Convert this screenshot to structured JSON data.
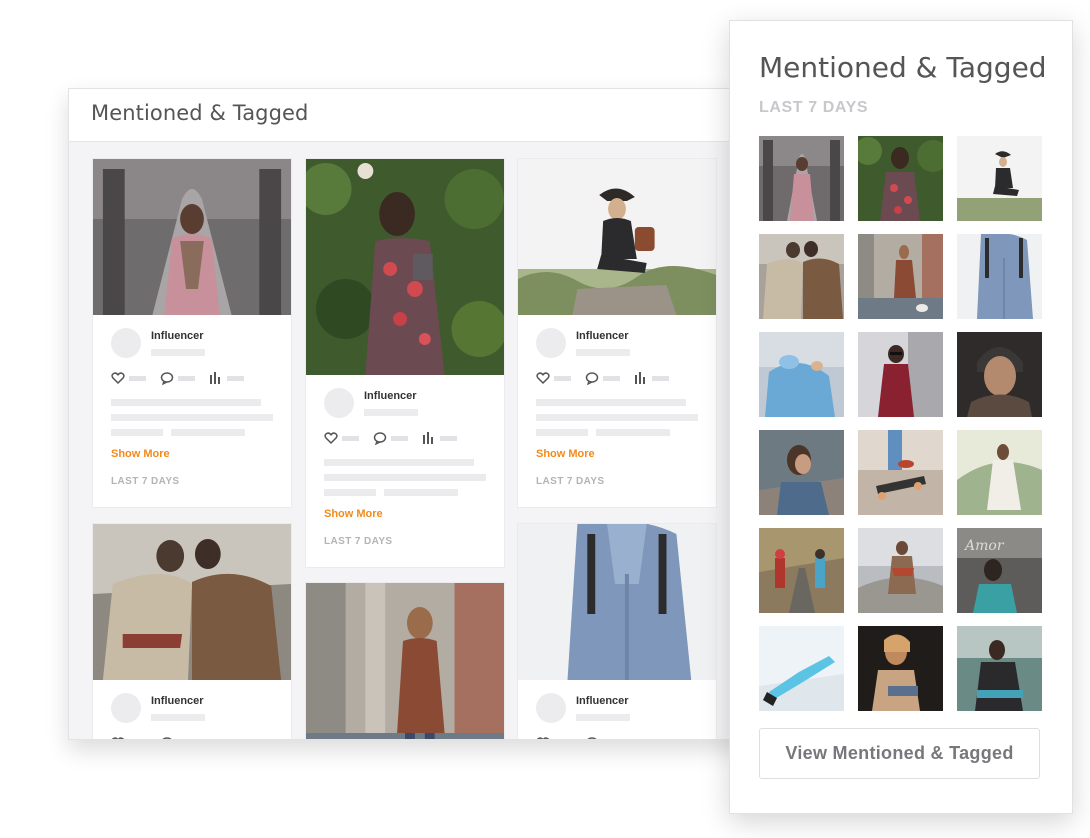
{
  "main_panel": {
    "title": "Mentioned & Tagged",
    "cards": [
      {
        "author": "Influencer",
        "show_more": "Show More",
        "period": "LAST 7 DAYS"
      },
      {
        "author": "Influencer",
        "show_more": "Show More",
        "period": "LAST 7 DAYS"
      },
      {
        "author": "Influencer",
        "show_more": "Show More",
        "period": "LAST 7 DAYS"
      },
      {
        "author": "Influencer"
      },
      {
        "author": "Influencer"
      }
    ]
  },
  "side_panel": {
    "title": "Mentioned & Tagged",
    "period": "LAST 7 DAYS",
    "view_button": "View Mentioned & Tagged"
  },
  "icons": [
    "heart-icon",
    "comment-icon",
    "stats-icon"
  ],
  "colors": {
    "accent": "#f28a1b",
    "placeholder": "#ebebee",
    "panel_bg": "#f4f4f6"
  }
}
